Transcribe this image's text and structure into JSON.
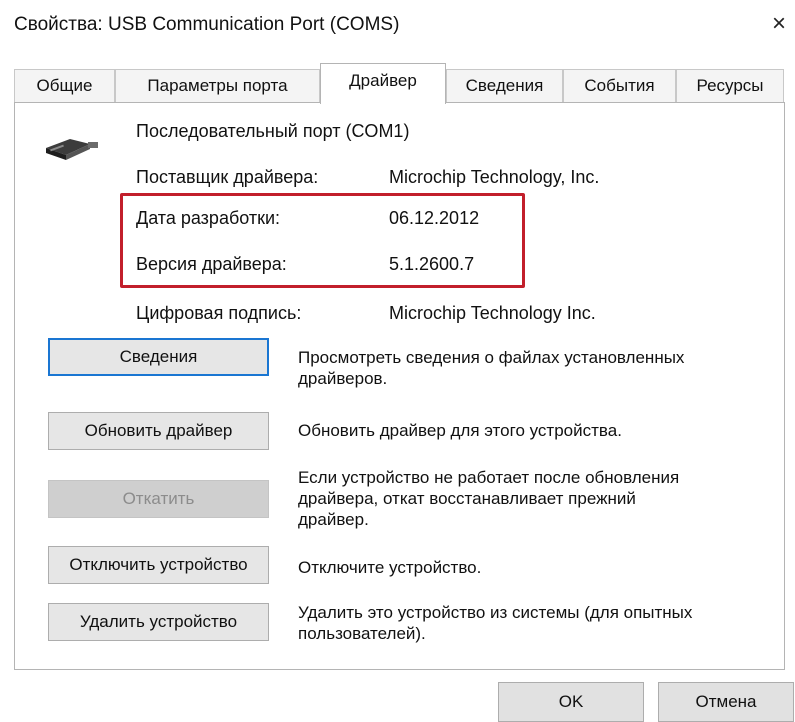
{
  "window": {
    "title": "Свойства: USB Communication Port (COMS)",
    "close_glyph": "×"
  },
  "tabs": [
    {
      "label": "Общие",
      "active": false
    },
    {
      "label": "Параметры порта",
      "active": false
    },
    {
      "label": "Драйвер",
      "active": true
    },
    {
      "label": "Сведения",
      "active": false
    },
    {
      "label": "События",
      "active": false
    },
    {
      "label": "Ресурсы",
      "active": false
    }
  ],
  "device": {
    "icon": "serial-port-icon",
    "name": "Последовательный порт (COM1)"
  },
  "driver_info": [
    {
      "label": "Поставщик драйвера:",
      "value": "Microchip Technology, Inc."
    },
    {
      "label": "Дата разработки:",
      "value": "06.12.2012"
    },
    {
      "label": "Версия драйвера:",
      "value": "5.1.2600.7"
    },
    {
      "label": "Цифровая подпись:",
      "value": "Microchip Technology Inc."
    }
  ],
  "highlight_color": "#c21f2b",
  "actions": [
    {
      "button": "Сведения",
      "description": "Просмотреть сведения о файлах установленных драйверов.",
      "state": "focused"
    },
    {
      "button": "Обновить драйвер",
      "description": "Обновить драйвер для этого устройства.",
      "state": "normal"
    },
    {
      "button": "Откатить",
      "description": "Если устройство не работает после обновления драйвера, откат восстанавливает прежний драйвер.",
      "state": "disabled"
    },
    {
      "button": "Отключить устройство",
      "description": "Отключите устройство.",
      "state": "normal"
    },
    {
      "button": "Удалить устройство",
      "description": "Удалить это устройство из системы (для опытных пользователей).",
      "state": "normal"
    }
  ],
  "footer": {
    "ok_label": "OK",
    "cancel_label": "Отмена"
  }
}
